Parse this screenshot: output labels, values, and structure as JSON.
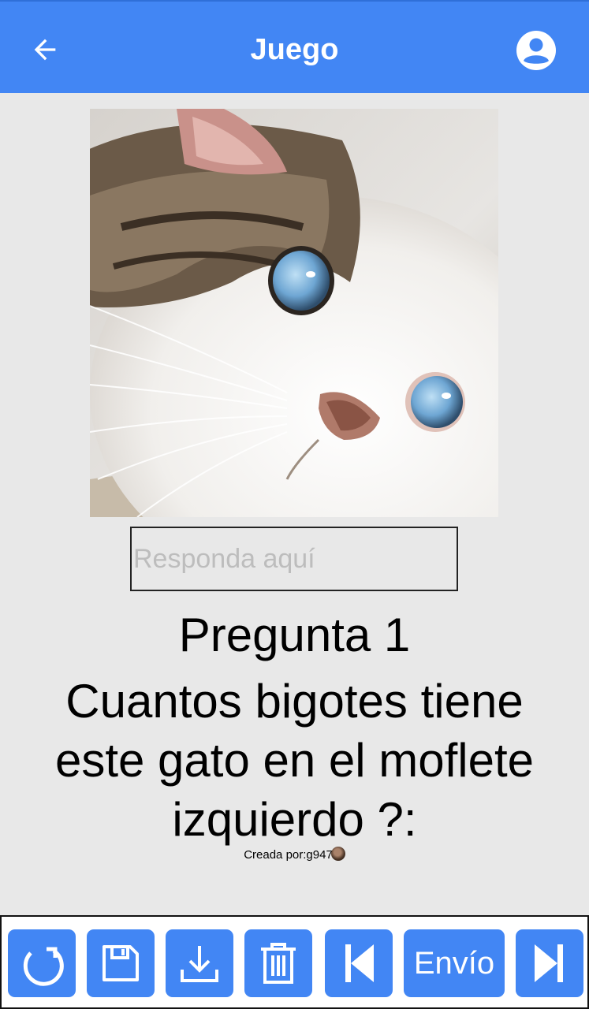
{
  "header": {
    "title": "Juego",
    "back_icon": "arrow-left-icon",
    "account_icon": "account-circle-icon"
  },
  "image": {
    "subject": "cat"
  },
  "answer": {
    "placeholder": "Responda aquí",
    "value": ""
  },
  "question": {
    "number_label": "Pregunta 1",
    "text": "Cuantos bigotes tiene este gato en el moflete izquierdo ?:"
  },
  "creator": {
    "text": "Creada por:g947"
  },
  "toolbar": {
    "buttons": [
      {
        "icon": "refresh-icon"
      },
      {
        "icon": "save-icon"
      },
      {
        "icon": "download-icon"
      },
      {
        "icon": "trash-icon"
      },
      {
        "icon": "skip-previous-icon"
      },
      {
        "label": "Envío"
      },
      {
        "icon": "skip-next-icon"
      }
    ]
  },
  "colors": {
    "accent": "#4286f4",
    "background": "#e8e8e8"
  }
}
